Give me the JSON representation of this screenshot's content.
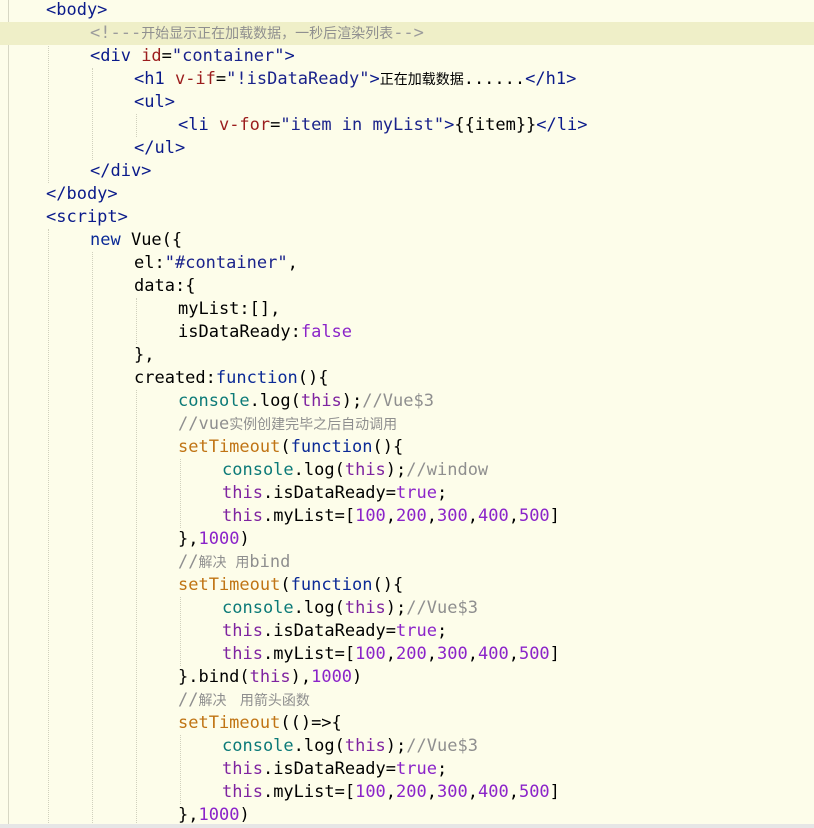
{
  "editor": {
    "highlighted_line": 1,
    "lines": [
      [
        {
          "t": "tag",
          "v": "<body>"
        }
      ],
      [
        {
          "t": "comment-html",
          "v": "<!---"
        },
        {
          "t": "cn-comment",
          "v": "开始显示正在加载数据，一秒后渲染列表"
        },
        {
          "t": "comment-html",
          "v": "-->"
        }
      ],
      [
        {
          "t": "tag",
          "v": "<div "
        },
        {
          "t": "attr",
          "v": "id"
        },
        {
          "t": "punc",
          "v": "="
        },
        {
          "t": "str",
          "v": "\"container\""
        },
        {
          "t": "tag",
          "v": ">"
        }
      ],
      [
        {
          "t": "tag",
          "v": "<h1 "
        },
        {
          "t": "attr",
          "v": "v-if"
        },
        {
          "t": "punc",
          "v": "="
        },
        {
          "t": "str",
          "v": "\"!isDataReady\""
        },
        {
          "t": "tag",
          "v": ">"
        },
        {
          "t": "cn",
          "v": "正在加载数据"
        },
        {
          "t": "plain",
          "v": "......"
        },
        {
          "t": "tag",
          "v": "</h1>"
        }
      ],
      [
        {
          "t": "tag",
          "v": "<ul>"
        }
      ],
      [
        {
          "t": "tag",
          "v": "<li "
        },
        {
          "t": "attr",
          "v": "v-for"
        },
        {
          "t": "punc",
          "v": "="
        },
        {
          "t": "str",
          "v": "\"item in myList\""
        },
        {
          "t": "tag",
          "v": ">"
        },
        {
          "t": "plain",
          "v": "{{item}}"
        },
        {
          "t": "tag",
          "v": "</li>"
        }
      ],
      [
        {
          "t": "tag",
          "v": "</ul>"
        }
      ],
      [
        {
          "t": "tag",
          "v": "</div>"
        }
      ],
      [
        {
          "t": "tag",
          "v": "</body>"
        }
      ],
      [
        {
          "t": "tag",
          "v": "<script>"
        }
      ],
      [
        {
          "t": "kw",
          "v": "new "
        },
        {
          "t": "plain",
          "v": "Vue({"
        }
      ],
      [
        {
          "t": "plain",
          "v": "el"
        },
        {
          "t": "punc",
          "v": ":"
        },
        {
          "t": "str",
          "v": "\"#container\""
        },
        {
          "t": "plain",
          "v": ","
        }
      ],
      [
        {
          "t": "plain",
          "v": "data"
        },
        {
          "t": "punc",
          "v": ":{"
        }
      ],
      [
        {
          "t": "plain",
          "v": "myList"
        },
        {
          "t": "punc",
          "v": ":[],"
        }
      ],
      [
        {
          "t": "plain",
          "v": "isDataReady"
        },
        {
          "t": "punc",
          "v": ":"
        },
        {
          "t": "bool",
          "v": "false"
        }
      ],
      [
        {
          "t": "plain",
          "v": "},"
        }
      ],
      [
        {
          "t": "plain",
          "v": "created"
        },
        {
          "t": "punc",
          "v": ":"
        },
        {
          "t": "kw",
          "v": "function"
        },
        {
          "t": "plain",
          "v": "(){"
        }
      ],
      [
        {
          "t": "obj",
          "v": "console"
        },
        {
          "t": "plain",
          "v": ".log("
        },
        {
          "t": "ttl",
          "v": "this"
        },
        {
          "t": "plain",
          "v": ");"
        },
        {
          "t": "comment",
          "v": "//Vue$3"
        }
      ],
      [
        {
          "t": "comment",
          "v": "//vue"
        },
        {
          "t": "cn-comment",
          "v": "实例创建完毕之后自动调用"
        }
      ],
      [
        {
          "t": "fn",
          "v": "setTimeout"
        },
        {
          "t": "plain",
          "v": "("
        },
        {
          "t": "kw",
          "v": "function"
        },
        {
          "t": "plain",
          "v": "(){"
        }
      ],
      [
        {
          "t": "obj",
          "v": "console"
        },
        {
          "t": "plain",
          "v": ".log("
        },
        {
          "t": "ttl",
          "v": "this"
        },
        {
          "t": "plain",
          "v": ");"
        },
        {
          "t": "comment",
          "v": "//window"
        }
      ],
      [
        {
          "t": "ttl",
          "v": "this"
        },
        {
          "t": "plain",
          "v": ".isDataReady="
        },
        {
          "t": "bool",
          "v": "true"
        },
        {
          "t": "plain",
          "v": ";"
        }
      ],
      [
        {
          "t": "ttl",
          "v": "this"
        },
        {
          "t": "plain",
          "v": ".myList=["
        },
        {
          "t": "num",
          "v": "100"
        },
        {
          "t": "plain",
          "v": ","
        },
        {
          "t": "num",
          "v": "200"
        },
        {
          "t": "plain",
          "v": ","
        },
        {
          "t": "num",
          "v": "300"
        },
        {
          "t": "plain",
          "v": ","
        },
        {
          "t": "num",
          "v": "400"
        },
        {
          "t": "plain",
          "v": ","
        },
        {
          "t": "num",
          "v": "500"
        },
        {
          "t": "plain",
          "v": "]"
        }
      ],
      [
        {
          "t": "plain",
          "v": "},"
        },
        {
          "t": "num",
          "v": "1000"
        },
        {
          "t": "plain",
          "v": ")"
        }
      ],
      [
        {
          "t": "comment",
          "v": "//"
        },
        {
          "t": "cn-comment",
          "v": "解决  用"
        },
        {
          "t": "comment",
          "v": "bind"
        }
      ],
      [
        {
          "t": "fn",
          "v": "setTimeout"
        },
        {
          "t": "plain",
          "v": "("
        },
        {
          "t": "kw",
          "v": "function"
        },
        {
          "t": "plain",
          "v": "(){"
        }
      ],
      [
        {
          "t": "obj",
          "v": "console"
        },
        {
          "t": "plain",
          "v": ".log("
        },
        {
          "t": "ttl",
          "v": "this"
        },
        {
          "t": "plain",
          "v": ");"
        },
        {
          "t": "comment",
          "v": "//Vue$3"
        }
      ],
      [
        {
          "t": "ttl",
          "v": "this"
        },
        {
          "t": "plain",
          "v": ".isDataReady="
        },
        {
          "t": "bool",
          "v": "true"
        },
        {
          "t": "plain",
          "v": ";"
        }
      ],
      [
        {
          "t": "ttl",
          "v": "this"
        },
        {
          "t": "plain",
          "v": ".myList=["
        },
        {
          "t": "num",
          "v": "100"
        },
        {
          "t": "plain",
          "v": ","
        },
        {
          "t": "num",
          "v": "200"
        },
        {
          "t": "plain",
          "v": ","
        },
        {
          "t": "num",
          "v": "300"
        },
        {
          "t": "plain",
          "v": ","
        },
        {
          "t": "num",
          "v": "400"
        },
        {
          "t": "plain",
          "v": ","
        },
        {
          "t": "num",
          "v": "500"
        },
        {
          "t": "plain",
          "v": "]"
        }
      ],
      [
        {
          "t": "plain",
          "v": "}.bind("
        },
        {
          "t": "ttl",
          "v": "this"
        },
        {
          "t": "plain",
          "v": "),"
        },
        {
          "t": "num",
          "v": "1000"
        },
        {
          "t": "plain",
          "v": ")"
        }
      ],
      [
        {
          "t": "comment",
          "v": "//"
        },
        {
          "t": "cn-comment",
          "v": "解决   用箭头函数"
        }
      ],
      [
        {
          "t": "fn",
          "v": "setTimeout"
        },
        {
          "t": "plain",
          "v": "(()=>{"
        }
      ],
      [
        {
          "t": "obj",
          "v": "console"
        },
        {
          "t": "plain",
          "v": ".log("
        },
        {
          "t": "ttl",
          "v": "this"
        },
        {
          "t": "plain",
          "v": ");"
        },
        {
          "t": "comment",
          "v": "//Vue$3"
        }
      ],
      [
        {
          "t": "ttl",
          "v": "this"
        },
        {
          "t": "plain",
          "v": ".isDataReady="
        },
        {
          "t": "bool",
          "v": "true"
        },
        {
          "t": "plain",
          "v": ";"
        }
      ],
      [
        {
          "t": "ttl",
          "v": "this"
        },
        {
          "t": "plain",
          "v": ".myList=["
        },
        {
          "t": "num",
          "v": "100"
        },
        {
          "t": "plain",
          "v": ","
        },
        {
          "t": "num",
          "v": "200"
        },
        {
          "t": "plain",
          "v": ","
        },
        {
          "t": "num",
          "v": "300"
        },
        {
          "t": "plain",
          "v": ","
        },
        {
          "t": "num",
          "v": "400"
        },
        {
          "t": "plain",
          "v": ","
        },
        {
          "t": "num",
          "v": "500"
        },
        {
          "t": "plain",
          "v": "]"
        }
      ],
      [
        {
          "t": "plain",
          "v": "},"
        },
        {
          "t": "num",
          "v": "1000"
        },
        {
          "t": "plain",
          "v": ")"
        }
      ]
    ]
  }
}
